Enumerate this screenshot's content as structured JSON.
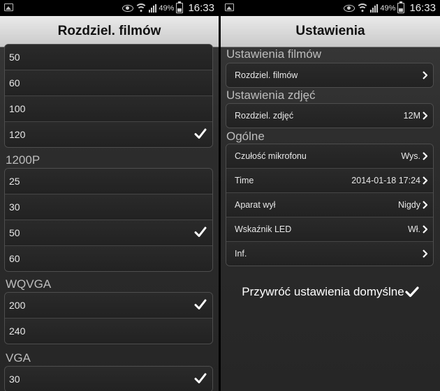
{
  "status": {
    "battery": "49%",
    "time": "16:33"
  },
  "left": {
    "title": "Rozdziel. filmów",
    "groups": [
      {
        "header": "",
        "items": [
          "50",
          "60",
          "100",
          "120"
        ]
      },
      {
        "header": "1200P",
        "items": [
          "25",
          "30",
          "50",
          "60"
        ]
      },
      {
        "header": "WQVGA",
        "items": [
          "200",
          "240"
        ]
      },
      {
        "header": "VGA",
        "items": [
          "30"
        ]
      }
    ]
  },
  "right": {
    "title": "Ustawienia",
    "sections": [
      {
        "header": "Ustawienia filmów",
        "rows": [
          {
            "label": "Rozdziel. filmów",
            "value": ""
          }
        ]
      },
      {
        "header": "Ustawienia zdjęć",
        "rows": [
          {
            "label": "Rozdziel. zdjęć",
            "value": "12M"
          }
        ]
      },
      {
        "header": "Ogólne",
        "rows": [
          {
            "label": "Czułość mikrofonu",
            "value": "Wys."
          },
          {
            "label": "Time",
            "value": "2014-01-18 17:24"
          },
          {
            "label": "Aparat wył",
            "value": "Nigdy"
          },
          {
            "label": "Wskaźnik LED",
            "value": "Wł."
          },
          {
            "label": "Inf.",
            "value": ""
          }
        ]
      }
    ],
    "reset_label": "Przywróć ustawienia domyślne"
  }
}
